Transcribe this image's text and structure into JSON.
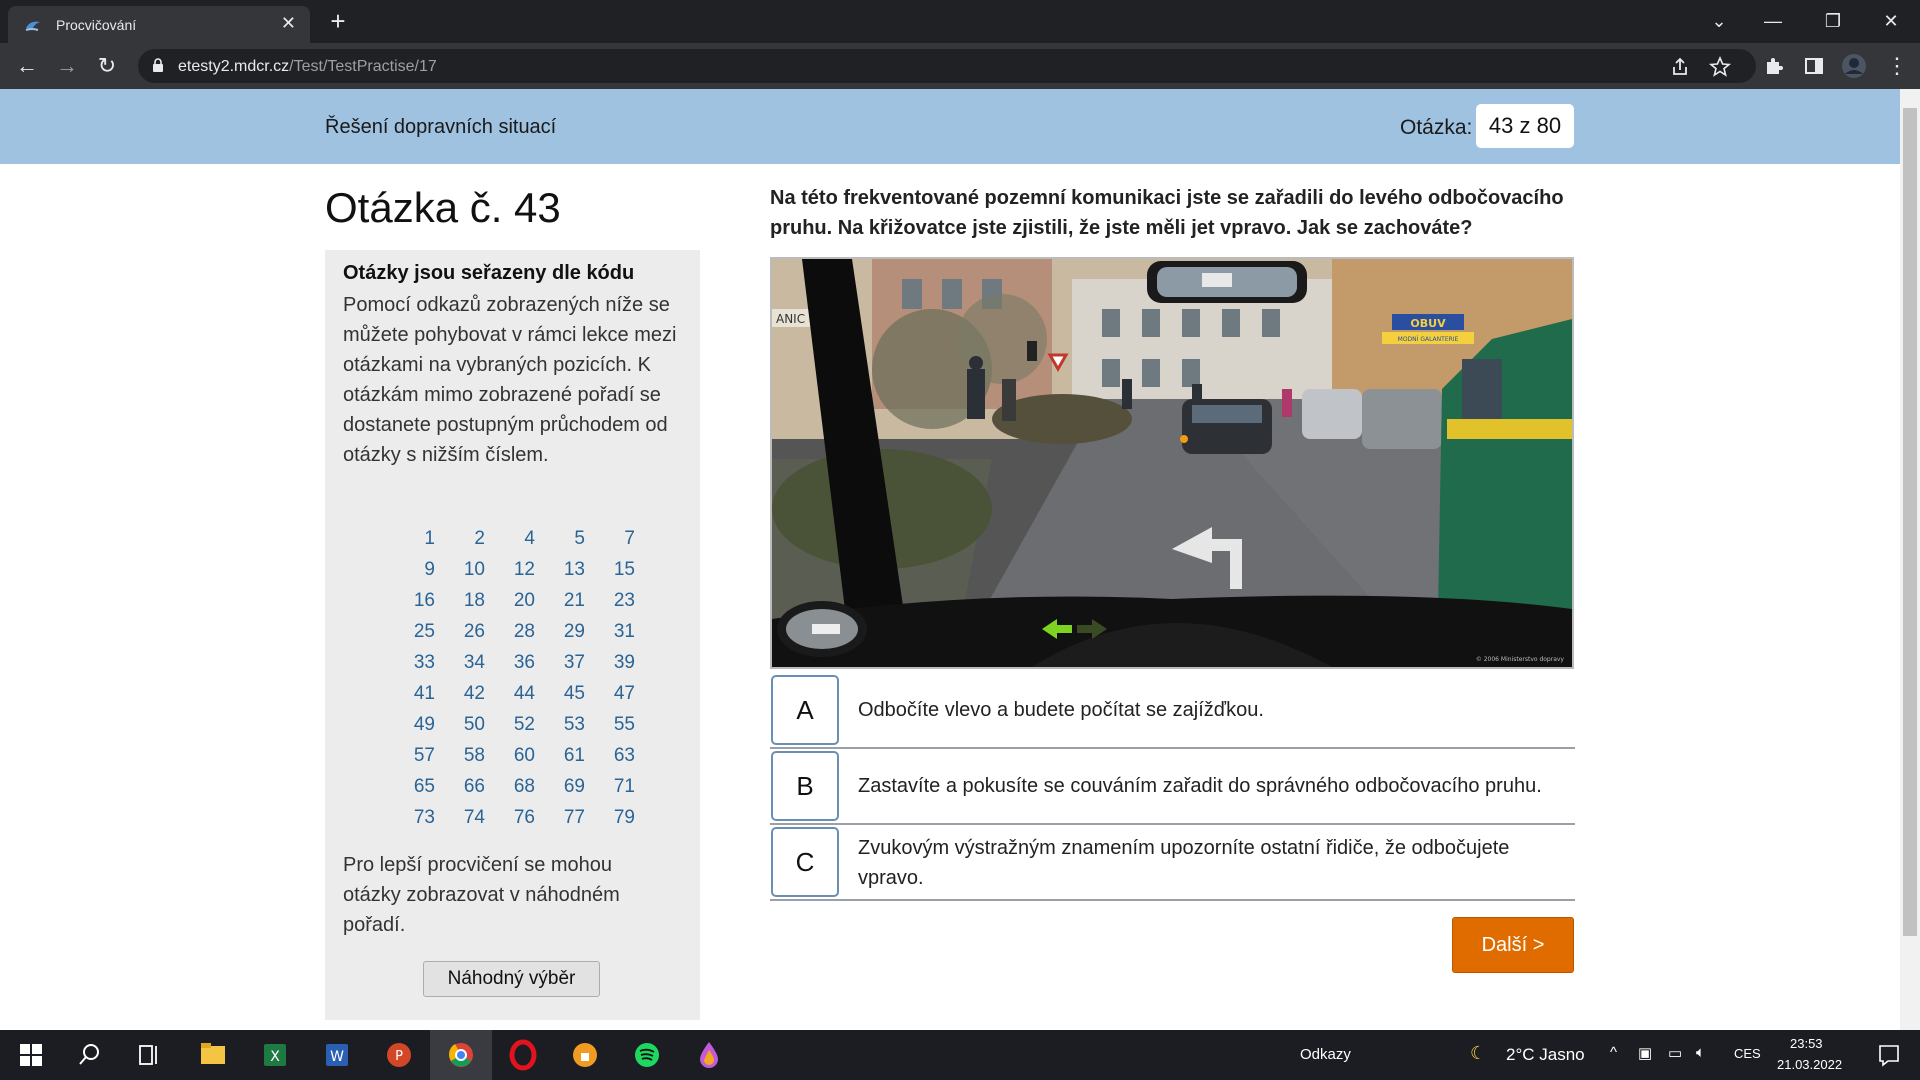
{
  "browser": {
    "tab_title": "Procvičování",
    "url_domain": "etesty2.mdcr.cz",
    "url_path": "/Test/TestPractise/17"
  },
  "header": {
    "section_title": "Řešení dopravních situací",
    "counter_label": "Otázka:",
    "counter_value": "43 z 80"
  },
  "question": {
    "title": "Otázka č. 43",
    "text": "Na této frekventované pozemní komunikaci jste se zařadili do levého odbočovacího pruhu. Na křižovatce jste zjistili, že jste měli jet vpravo. Jak se zachováte?",
    "answers": [
      {
        "letter": "A",
        "text": "Odbočíte vlevo a budete počítat se zajížďkou."
      },
      {
        "letter": "B",
        "text": "Zastavíte a pokusíte se couváním zařadit do správného odbočovacího pruhu."
      },
      {
        "letter": "C",
        "text": "Zvukovým výstražným znamením upozorníte ostatní řidiče, že odbočujete vpravo."
      }
    ],
    "next_label": "Další >"
  },
  "sidebar": {
    "heading": "Otázky jsou seřazeny dle kódu",
    "text": "Pomocí odkazů zobrazených níže se můžete pohybovat v rámci lekce mezi otázkami na vybraných pozicích. K otázkám mimo zobrazené pořadí se dostanete postupným průchodem od otázky s nižším číslem.",
    "numbers": [
      [
        "1",
        "2",
        "4",
        "5",
        "7"
      ],
      [
        "9",
        "10",
        "12",
        "13",
        "15"
      ],
      [
        "16",
        "18",
        "20",
        "21",
        "23"
      ],
      [
        "25",
        "26",
        "28",
        "29",
        "31"
      ],
      [
        "33",
        "34",
        "36",
        "37",
        "39"
      ],
      [
        "41",
        "42",
        "44",
        "45",
        "47"
      ],
      [
        "49",
        "50",
        "52",
        "53",
        "55"
      ],
      [
        "57",
        "58",
        "60",
        "61",
        "63"
      ],
      [
        "65",
        "66",
        "68",
        "69",
        "71"
      ],
      [
        "73",
        "74",
        "76",
        "77",
        "79"
      ]
    ],
    "random_text": "Pro lepší procvičení se mohou otázky zobrazovat v náhodném pořadí.",
    "random_button": "Náhodný výběr"
  },
  "scene_labels": {
    "shop_sign": "OBUV",
    "shop_sub": "MODNÍ GALANTERIE",
    "left_sign": "ANIC",
    "watermark": "© 2006 Ministerstvo dopravy"
  },
  "taskbar": {
    "links_label": "Odkazy",
    "weather": "2°C  Jasno",
    "language": "CES",
    "time": "23:53",
    "date": "21.03.2022"
  },
  "colors": {
    "header_band": "#9ec2e0",
    "link": "#2a6496",
    "next_button": "#e06c00"
  }
}
